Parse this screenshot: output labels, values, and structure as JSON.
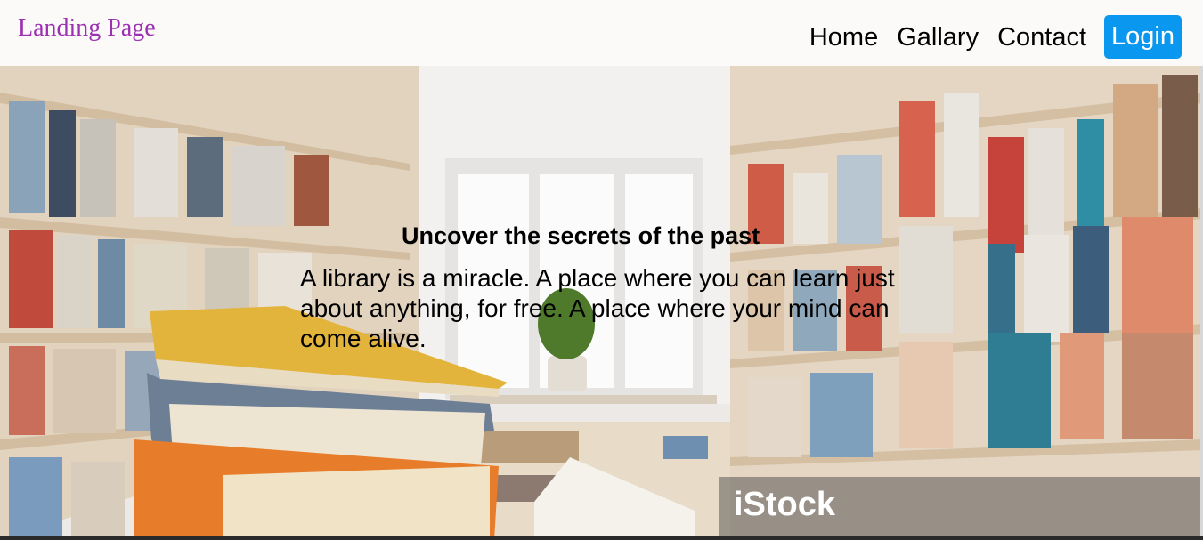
{
  "navbar": {
    "brand": "Landing Page",
    "links": [
      "Home",
      "Gallary",
      "Contact"
    ],
    "login": "Login"
  },
  "hero": {
    "title": "Uncover the secrets of the past",
    "text": "A library is a miracle. A place where you can learn just about anything, for free. A place where your mind can come alive.",
    "watermark": "iStock"
  },
  "colors": {
    "brand": "#9b30b0",
    "login_bg": "#0a97f0"
  }
}
